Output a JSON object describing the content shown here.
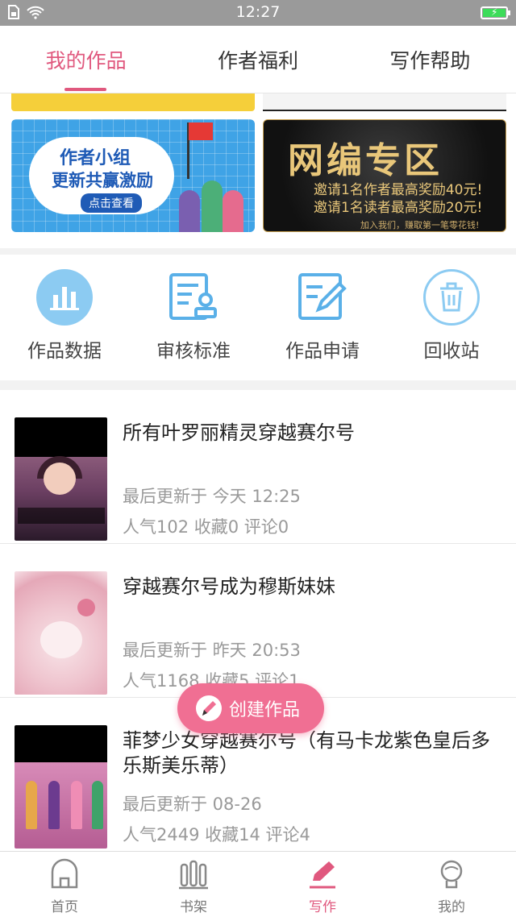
{
  "status_bar": {
    "time": "12:27",
    "icons": [
      "sim-icon",
      "wifi-icon",
      "battery-charging-icon"
    ]
  },
  "tabs": [
    {
      "label": "我的作品",
      "active": true
    },
    {
      "label": "作者福利",
      "active": false
    },
    {
      "label": "写作帮助",
      "active": false
    }
  ],
  "banners": {
    "left": {
      "title": "作者小组",
      "subtitle": "更新共赢激励",
      "button": "点击查看"
    },
    "right": {
      "title": "网编专区",
      "line1": "邀请1名作者最高奖励40元!",
      "line2": "邀请1名读者最高奖励20元!",
      "footer": "加入我们，赚取第一笔零花钱!"
    }
  },
  "actions": [
    {
      "label": "作品数据",
      "icon": "bar-chart-icon"
    },
    {
      "label": "审核标准",
      "icon": "review-standard-icon"
    },
    {
      "label": "作品申请",
      "icon": "edit-document-icon"
    },
    {
      "label": "回收站",
      "icon": "trash-icon"
    }
  ],
  "works": [
    {
      "title": "所有叶罗丽精灵穿越赛尔号",
      "updated": "最后更新于 今天 12:25",
      "stats": "人气102 收藏0 评论0"
    },
    {
      "title": "穿越赛尔号成为穆斯妹妹",
      "updated": "最后更新于 昨天 20:53",
      "stats": "人气1168 收藏5 评论1"
    },
    {
      "title": "菲梦少女穿越赛尔号（有马卡龙紫色皇后多乐斯美乐蒂）",
      "updated": "最后更新于 08-26",
      "stats": "人气2449 收藏14 评论4"
    }
  ],
  "create_button": {
    "label": "创建作品"
  },
  "bottom_nav": [
    {
      "label": "首页",
      "icon": "home-icon",
      "active": false
    },
    {
      "label": "书架",
      "icon": "bookshelf-icon",
      "active": false
    },
    {
      "label": "写作",
      "icon": "pen-icon",
      "active": true
    },
    {
      "label": "我的",
      "icon": "profile-icon",
      "active": false
    }
  ],
  "colors": {
    "accent": "#e0587e",
    "create_button": "#f06f93",
    "icon_blue": "#5ab0e8",
    "muted_text": "#999999"
  }
}
